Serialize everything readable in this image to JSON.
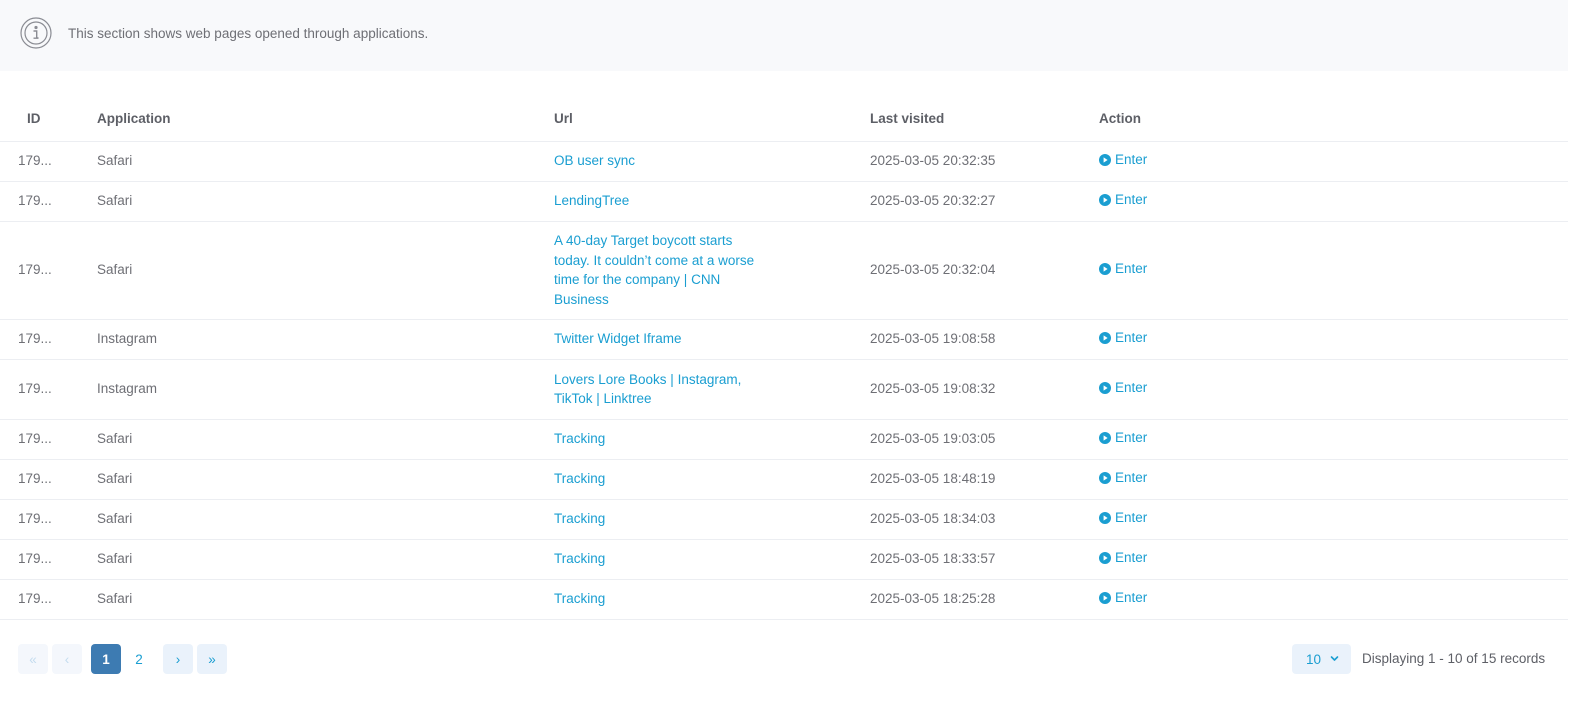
{
  "info": {
    "icon": "info-icon",
    "text": "This section shows web pages opened through applications."
  },
  "table": {
    "headers": {
      "id": "ID",
      "application": "Application",
      "url": "Url",
      "last_visited": "Last visited",
      "action": "Action"
    },
    "rows": [
      {
        "id": "179...",
        "application": "Safari",
        "url": "OB user sync",
        "last_visited": "2025-03-05 20:32:35",
        "action": "Enter"
      },
      {
        "id": "179...",
        "application": "Safari",
        "url": "LendingTree",
        "last_visited": "2025-03-05 20:32:27",
        "action": "Enter"
      },
      {
        "id": "179...",
        "application": "Safari",
        "url": "A 40-day Target boycott starts today. It couldn’t come at a worse time for the company | CNN Business",
        "last_visited": "2025-03-05 20:32:04",
        "action": "Enter"
      },
      {
        "id": "179...",
        "application": "Instagram",
        "url": "Twitter Widget Iframe",
        "last_visited": "2025-03-05 19:08:58",
        "action": "Enter"
      },
      {
        "id": "179...",
        "application": "Instagram",
        "url": "Lovers Lore Books | Instagram, TikTok | Linktree",
        "last_visited": "2025-03-05 19:08:32",
        "action": "Enter"
      },
      {
        "id": "179...",
        "application": "Safari",
        "url": "Tracking",
        "last_visited": "2025-03-05 19:03:05",
        "action": "Enter"
      },
      {
        "id": "179...",
        "application": "Safari",
        "url": "Tracking",
        "last_visited": "2025-03-05 18:48:19",
        "action": "Enter"
      },
      {
        "id": "179...",
        "application": "Safari",
        "url": "Tracking",
        "last_visited": "2025-03-05 18:34:03",
        "action": "Enter"
      },
      {
        "id": "179...",
        "application": "Safari",
        "url": "Tracking",
        "last_visited": "2025-03-05 18:33:57",
        "action": "Enter"
      },
      {
        "id": "179...",
        "application": "Safari",
        "url": "Tracking",
        "last_visited": "2025-03-05 18:25:28",
        "action": "Enter"
      }
    ]
  },
  "pagination": {
    "first": "«",
    "prev": "‹",
    "pages": [
      "1",
      "2"
    ],
    "current_page": "1",
    "next": "›",
    "last": "»",
    "per_page": "10",
    "records_text": "Displaying 1 - 10 of 15 records"
  },
  "colors": {
    "link": "#1a9ed1",
    "active_page": "#3d7bb2",
    "banner_bg": "#f8f9fb"
  }
}
